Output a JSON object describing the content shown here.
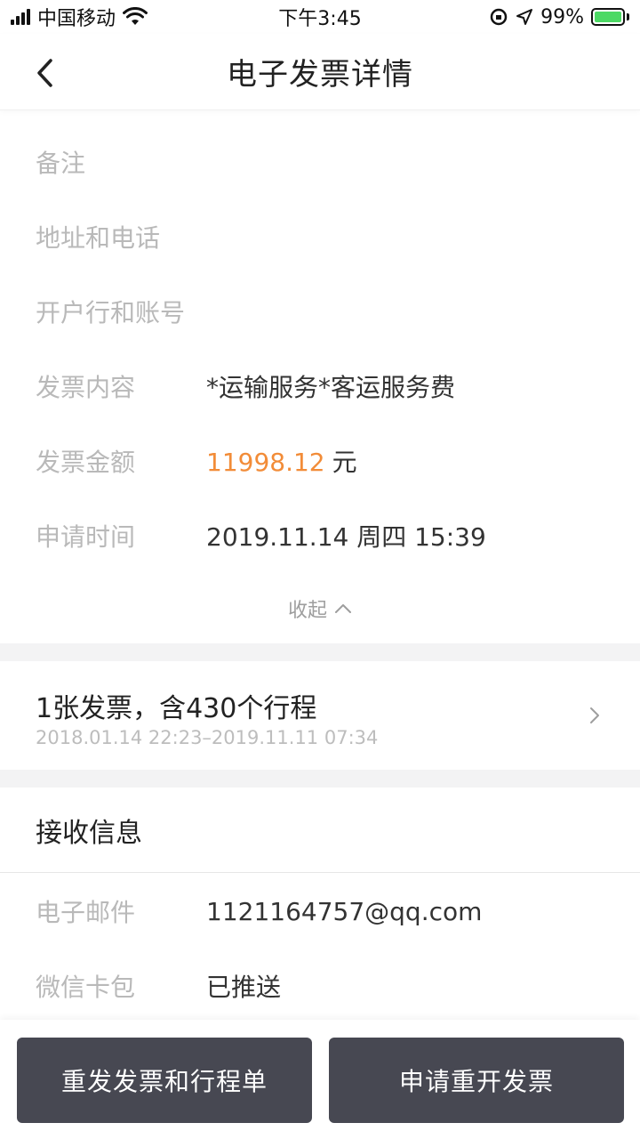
{
  "status_bar": {
    "carrier": "中国移动",
    "time": "下午3:45",
    "battery": "99%",
    "battery_color": "#4cd964"
  },
  "nav": {
    "title": "电子发票详情",
    "back_icon": "chevron-left-icon"
  },
  "invoice_details": [
    {
      "label": "备注",
      "value": ""
    },
    {
      "label": "地址和电话",
      "value": ""
    },
    {
      "label": "开户行和账号",
      "value": ""
    },
    {
      "label": "发票内容",
      "value": "*运输服务*客运服务费"
    },
    {
      "label": "发票金额",
      "amount": "11998.12",
      "unit": "元"
    },
    {
      "label": "申请时间",
      "value": "2019.11.14 周四 15:39"
    }
  ],
  "collapse": {
    "label": "收起",
    "icon": "chevron-up-icon"
  },
  "trip_summary": {
    "title": "1张发票，含430个行程",
    "range": "2018.01.14 22:23–2019.11.11 07:34",
    "icon": "chevron-right-icon"
  },
  "receive_info": {
    "heading": "接收信息",
    "rows": [
      {
        "label": "电子邮件",
        "value": "1121164757@qq.com"
      },
      {
        "label": "微信卡包",
        "value": "已推送"
      }
    ]
  },
  "actions": {
    "resend_label": "重发发票和行程单",
    "reissue_label": "申请重开发票",
    "button_color": "#474852"
  },
  "colors": {
    "accent_amount": "#f28c38",
    "label_gray": "#b9b9b9"
  }
}
